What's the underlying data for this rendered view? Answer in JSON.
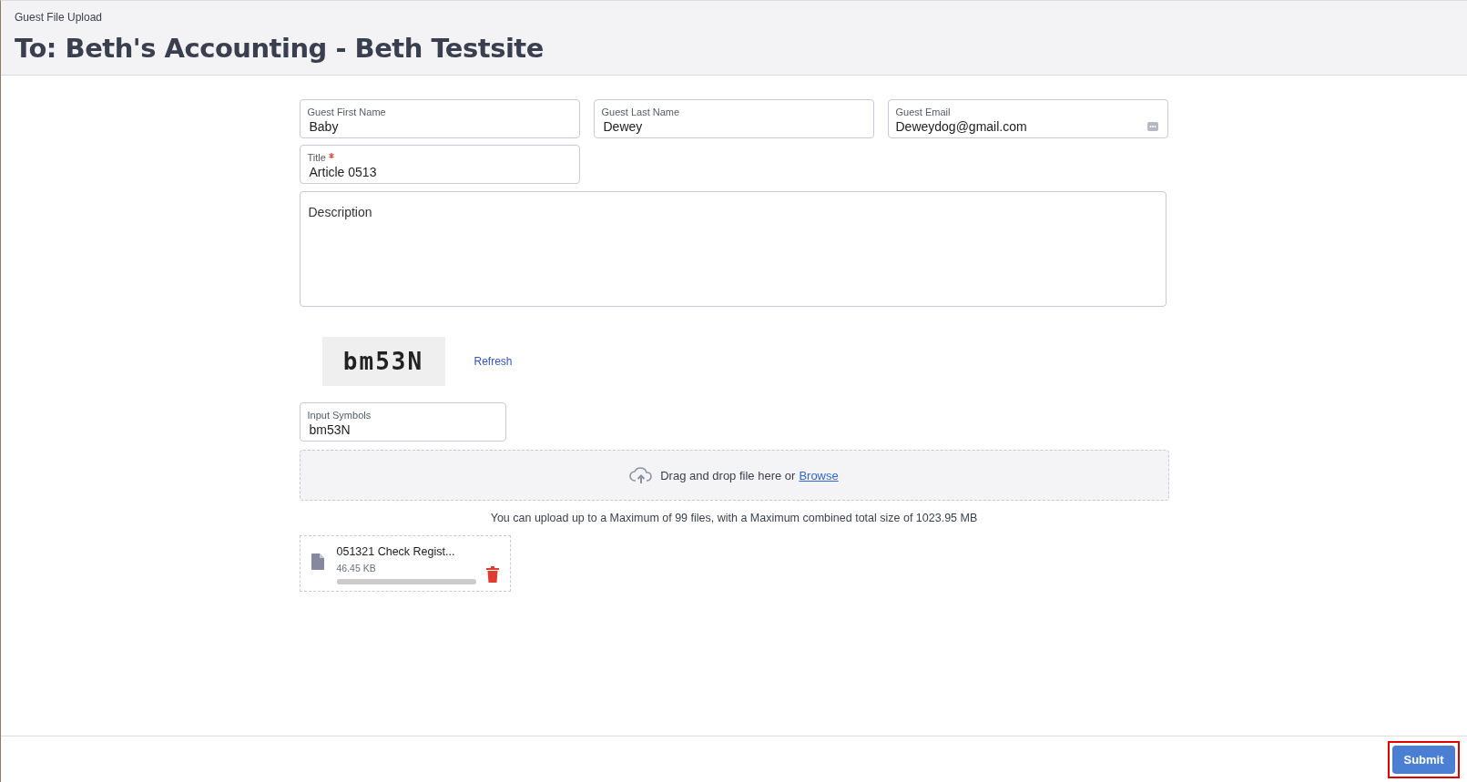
{
  "header": {
    "subtitle": "Guest File Upload",
    "title": "To: Beth's Accounting - Beth Testsite"
  },
  "fields": [
    {
      "label": "Guest First Name",
      "value": "Baby",
      "required": false,
      "kind": "text"
    },
    {
      "label": "Guest Last Name",
      "value": "Dewey",
      "required": false,
      "kind": "text"
    },
    {
      "label": "Guest Email",
      "value": "Deweydog@gmail.com",
      "required": false,
      "kind": "email"
    },
    {
      "label": "Title",
      "value": "Article 0513",
      "required": true,
      "kind": "text"
    }
  ],
  "description": {
    "placeholder": "Description"
  },
  "captcha": {
    "text": "bm53N",
    "refresh": "Refresh",
    "input_label": "Input Symbols",
    "input_value": "bm53N"
  },
  "dropzone": {
    "text": "Drag and drop file here or",
    "link": "Browse"
  },
  "limit_note": "You can upload up to a Maximum of 99 files, with a Maximum combined total size of 1023.95 MB",
  "files": [
    {
      "name": "051321 Check Regist...",
      "size": "46.45 KB",
      "level": 1
    }
  ],
  "footer": {
    "submit": "Submit",
    "highlighted": true
  }
}
